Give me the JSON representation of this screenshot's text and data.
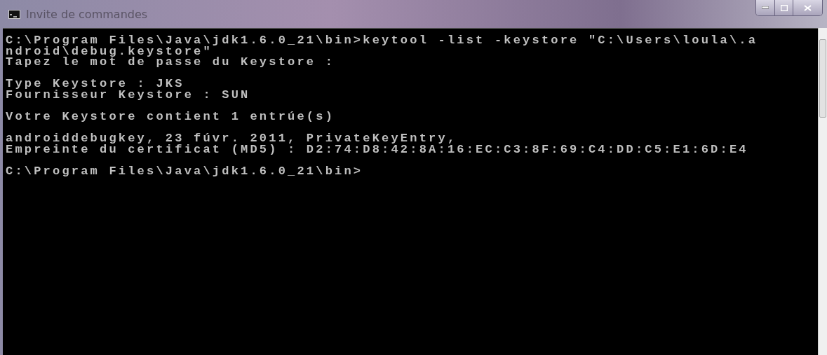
{
  "window": {
    "title": "Invite de commandes"
  },
  "console": {
    "blocks": [
      [
        "C:\\Program Files\\Java\\jdk1.6.0_21\\bin>keytool -list -keystore \"C:\\Users\\loula\\.a",
        "ndroid\\debug.keystore\"",
        "Tapez le mot de passe du Keystore :"
      ],
      [
        "Type Keystore : JKS",
        "Fournisseur Keystore : SUN"
      ],
      [
        "Votre Keystore contient 1 entrúe(s)"
      ],
      [
        "androiddebugkey, 23 fúvr. 2011, PrivateKeyEntry,",
        "Empreinte du certificat (MD5) : D2:74:D8:42:8A:16:EC:C3:8F:69:C4:DD:C5:E1:6D:E4"
      ],
      [
        "C:\\Program Files\\Java\\jdk1.6.0_21\\bin>"
      ]
    ]
  }
}
